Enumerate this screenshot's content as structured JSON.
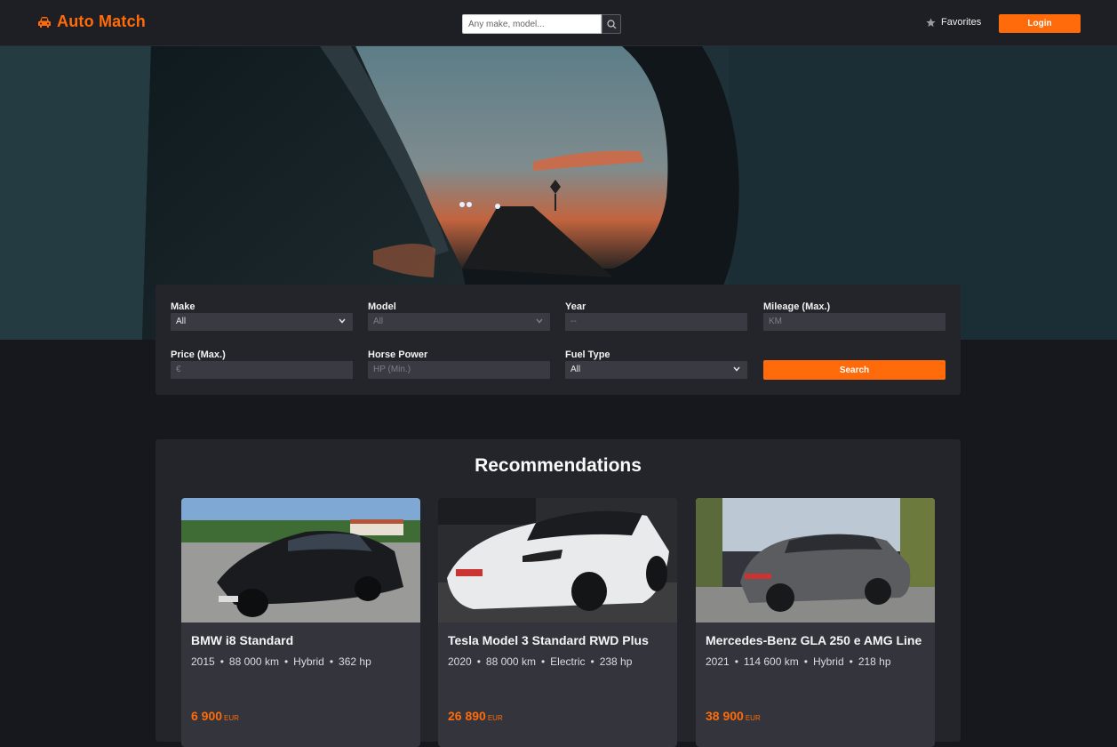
{
  "header": {
    "brand": "Auto Match",
    "search_placeholder": "Any make, model...",
    "favorites_label": "Favorites",
    "login_label": "Login"
  },
  "filters": {
    "make": {
      "label": "Make",
      "value": "All"
    },
    "model": {
      "label": "Model",
      "value": "All"
    },
    "year": {
      "label": "Year",
      "value": "--"
    },
    "mileage": {
      "label": "Mileage (Max.)",
      "placeholder": "KM"
    },
    "price": {
      "label": "Price (Max.)",
      "placeholder": "€"
    },
    "horse_power": {
      "label": "Horse Power",
      "placeholder": "HP (Min.)"
    },
    "fuel_type": {
      "label": "Fuel Type",
      "value": "All"
    },
    "search_label": "Search"
  },
  "recommendations": {
    "title": "Recommendations",
    "cards": [
      {
        "name": "BMW i8 Standard",
        "year": "2015",
        "mileage": "88 000 km",
        "fuel": "Hybrid",
        "power": "362 hp",
        "price": "6 900",
        "currency": "EUR"
      },
      {
        "name": "Tesla Model 3 Standard RWD Plus",
        "year": "2020",
        "mileage": "88 000 km",
        "fuel": "Electric",
        "power": "238 hp",
        "price": "26 890",
        "currency": "EUR"
      },
      {
        "name": "Mercedes-Benz GLA 250 e AMG Line",
        "year": "2021",
        "mileage": "114 600 km",
        "fuel": "Hybrid",
        "power": "218 hp",
        "price": "38 900",
        "currency": "EUR"
      }
    ]
  },
  "colors": {
    "accent": "#ff6b0a",
    "background": "#17181d",
    "panel": "#24252b"
  }
}
